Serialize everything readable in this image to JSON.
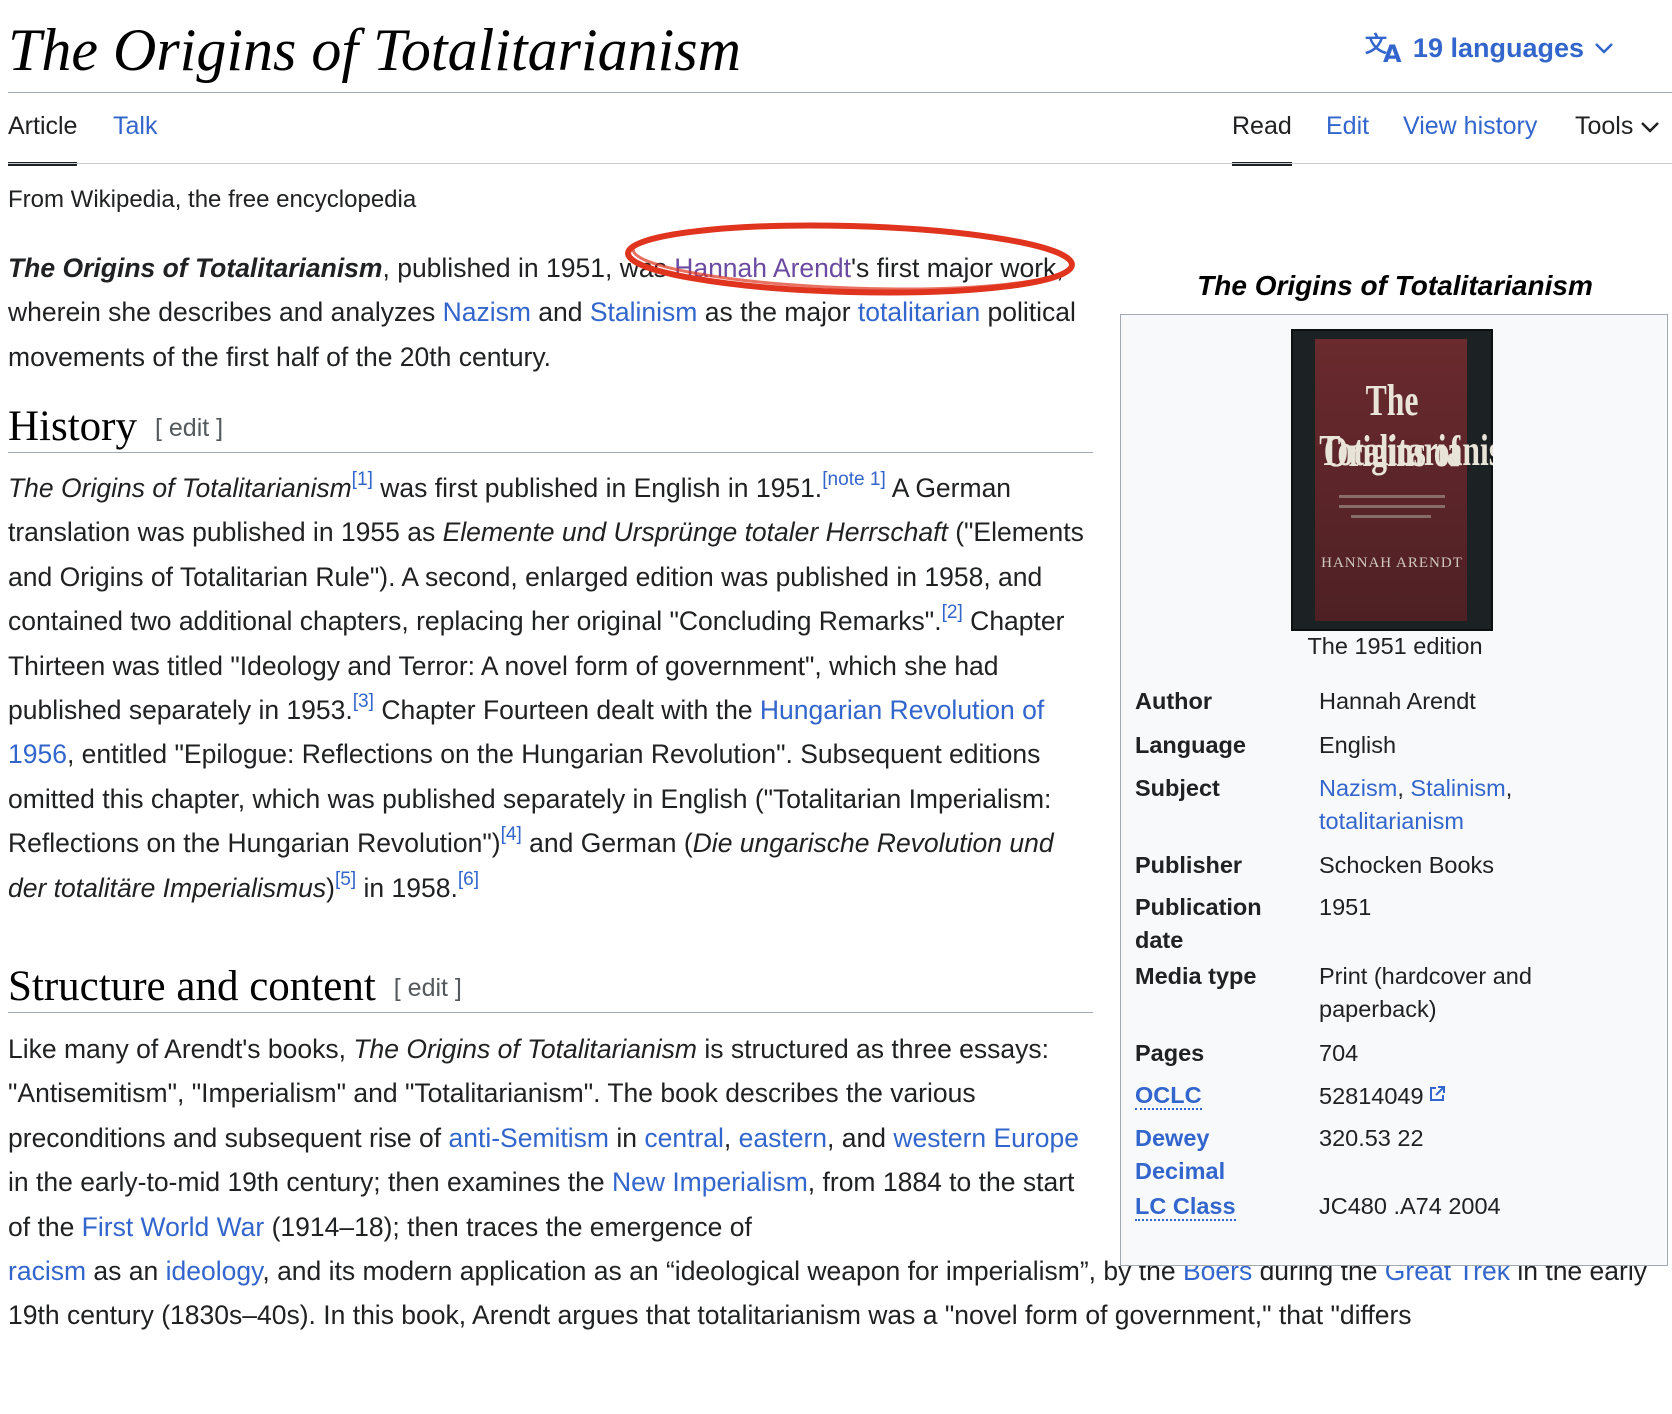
{
  "header": {
    "title": "The Origins of Totalitarianism",
    "languages_label": "19 languages",
    "tabs": {
      "article": "Article",
      "talk": "Talk",
      "read": "Read",
      "edit": "Edit",
      "view_history": "View history",
      "tools": "Tools"
    },
    "tagline": "From Wikipedia, the free encyclopedia"
  },
  "lead": {
    "title_bold": "The Origins of Totalitarianism",
    "t1": ", published in 1951, was ",
    "link_arendt": "Hannah Arendt",
    "t2": "'s first major work, wherein she describes and analyzes ",
    "link_nazism": "Nazism",
    "t3": " and ",
    "link_stalinism": "Stalinism",
    "t4": " as the major ",
    "link_totalitarian": "totalitarian",
    "t5": " political movements of the first half of the 20th century."
  },
  "history": {
    "heading": "History",
    "edit_label": "[ edit ]",
    "i1": "The Origins of Totalitarianism",
    "ref1": "[1]",
    "t1": " was first published in English in 1951.",
    "note1": "[note 1]",
    "t2": " A German translation was published in 1955 as ",
    "i2": "Elemente und Ursprünge totaler Herrschaft",
    "t3": " (\"Elements and Origins of Totalitarian Rule\"). A second, enlarged edition was published in 1958, and contained two additional chapters, replacing her original \"Concluding Remarks\".",
    "ref2": "[2]",
    "t4": " Chapter Thirteen was titled \"Ideology and Terror: A novel form of government\", which she had published separately in 1953.",
    "ref3": "[3]",
    "t5": " Chapter Fourteen dealt with the ",
    "link_hungarian": "Hungarian Revolution of 1956",
    "t6": ", entitled \"Epilogue: Reflections on the Hungarian Revolution\". Subsequent editions omitted this chapter, which was published separately in English (\"Totalitarian Imperialism: Reflections on the Hungarian Revolution\")",
    "ref4": "[4]",
    "t7": " and German (",
    "i3": "Die ungarische Revolution und der totalitäre Imperialismus",
    "t8": ")",
    "ref5": "[5]",
    "t9": " in 1958.",
    "ref6": "[6]"
  },
  "structure": {
    "heading": "Structure and content",
    "edit_label": "[ edit ]",
    "t1": "Like many of Arendt's books, ",
    "i1": "The Origins of Totalitarianism",
    "t2": " is structured as three essays: \"Antisemitism\", \"Imperialism\" and \"Totalitarianism\". The book describes the various preconditions and subsequent rise of ",
    "link_antisemitism": "anti-Semitism",
    "t3": " in ",
    "link_central": "central",
    "t4": ", ",
    "link_eastern": "eastern",
    "t5": ", and ",
    "link_western": "western Europe",
    "t6": " in the early-to-mid 19th century; then examines the ",
    "link_newimp": "New Imperialism",
    "t7": ", from 1884 to the start of the ",
    "link_ww1": "First World War",
    "t8": " (1914–18); then traces the emergence of ",
    "link_racism": "racism",
    "t9": " as an ",
    "link_ideology": "ideology",
    "t10": ", and its modern application as an “ideological weapon for imperialism”, by the ",
    "link_boers": "Boers",
    "t11": " during the ",
    "link_trek": "Great Trek",
    "t12": " in the early 19th century (1830s–40s). In this book, Arendt argues that totalitarianism was a \"novel form of government,\" that \"differs"
  },
  "infobox": {
    "title": "The Origins of Totalitarianism",
    "cover": {
      "line1": "The Origins of",
      "line2": "Totalitarianism",
      "author": "HANNAH ARENDT"
    },
    "image_caption": "The 1951 edition",
    "rows": {
      "author": {
        "label": "Author",
        "value": "Hannah Arendt"
      },
      "language": {
        "label": "Language",
        "value": "English"
      },
      "subject": {
        "label": "Subject",
        "v1": "Nazism",
        "sep1": ", ",
        "v2": "Stalinism",
        "sep2": ",",
        "v3": "totalitarianism"
      },
      "publisher": {
        "label": "Publisher",
        "value": "Schocken Books"
      },
      "pubdate": {
        "label1": "Publication",
        "label2": "date",
        "value": "1951"
      },
      "media": {
        "label": "Media type",
        "v1": "Print (hardcover and",
        "v2": "paperback)"
      },
      "pages": {
        "label": "Pages",
        "value": "704"
      },
      "oclc": {
        "label": "OCLC",
        "value": "52814049"
      },
      "dewey": {
        "label1": "Dewey",
        "label2": "Decimal",
        "value": "320.53 22"
      },
      "lcclass": {
        "label": "LC Class",
        "value": "JC480 .A74 2004"
      }
    }
  },
  "colors": {
    "link": "#3366cc",
    "visited": "#6b4ba1",
    "annotation": "#e0341f"
  }
}
